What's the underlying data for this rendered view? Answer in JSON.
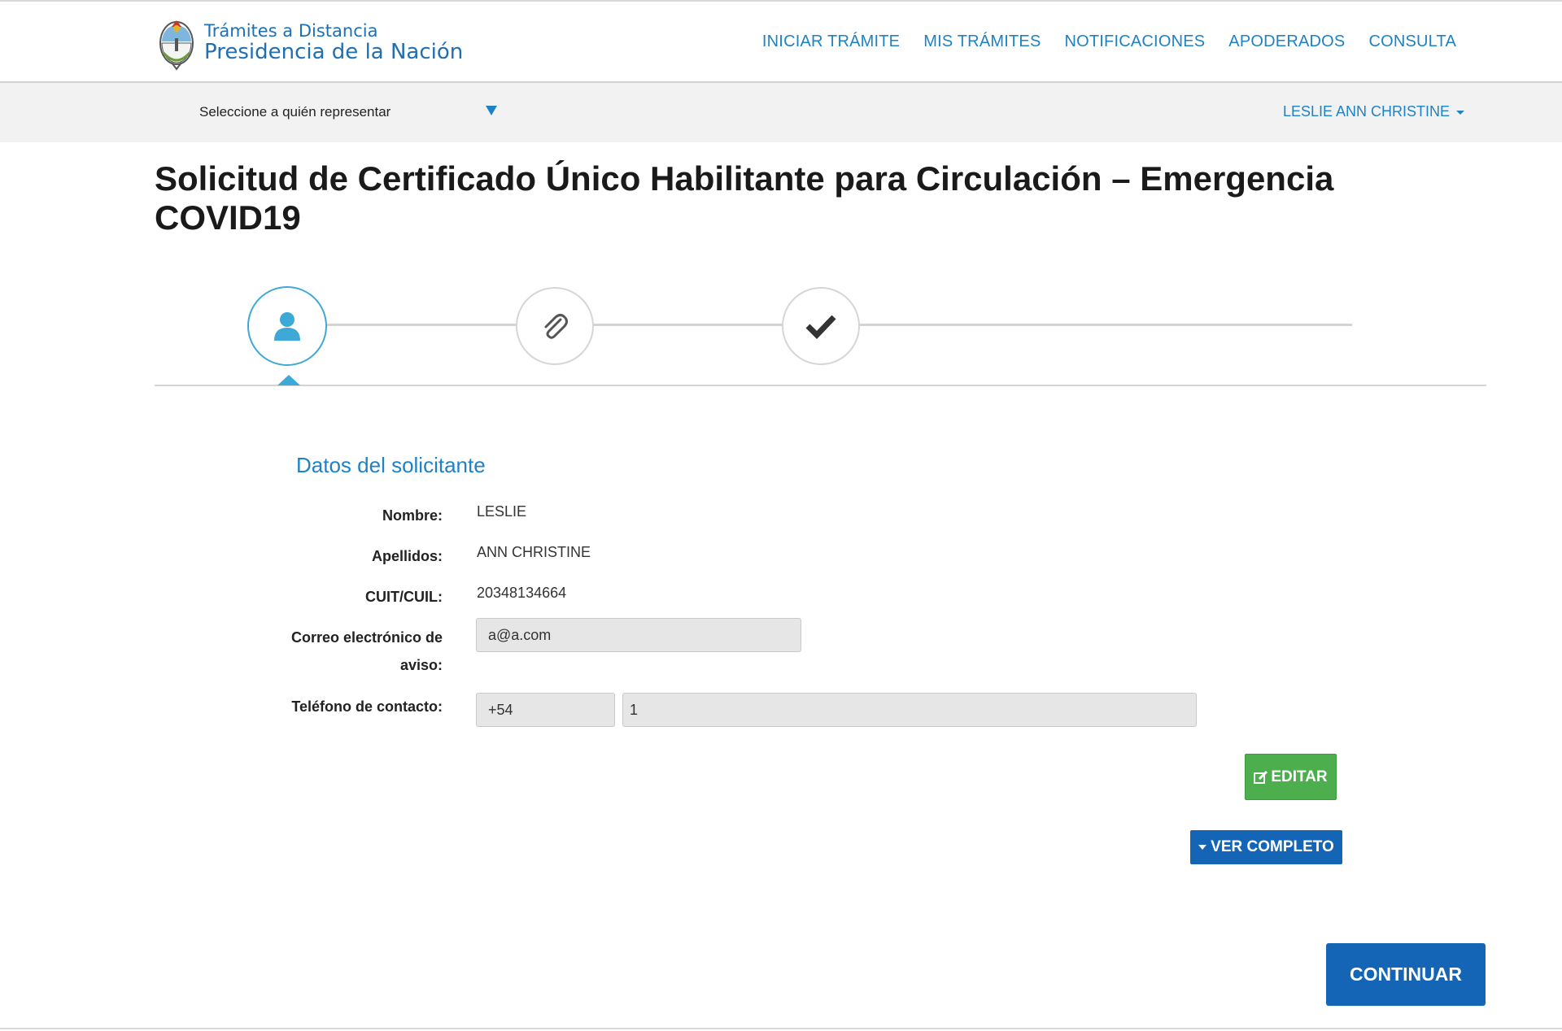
{
  "header": {
    "logo_line1": "Trámites a Distancia",
    "logo_line2": "Presidencia de la Nación",
    "nav": [
      {
        "label": "INICIAR TRÁMITE"
      },
      {
        "label": "MIS TRÁMITES"
      },
      {
        "label": "NOTIFICACIONES"
      },
      {
        "label": "APODERADOS"
      },
      {
        "label": "CONSULTA"
      }
    ]
  },
  "subbar": {
    "represent_placeholder": "Seleccione a quién representar",
    "user_name": "LESLIE ANN CHRISTINE"
  },
  "page_title": "Solicitud de Certificado Único Habilitante para Circulación – Emergencia COVID19",
  "stepper": {
    "steps": [
      {
        "icon": "user-icon",
        "state": "active"
      },
      {
        "icon": "paperclip-icon",
        "state": "pending"
      },
      {
        "icon": "check-icon",
        "state": "pending"
      }
    ]
  },
  "form": {
    "section_title": "Datos del solicitante",
    "nombre_label": "Nombre:",
    "nombre_value": "LESLIE",
    "apellidos_label": "Apellidos:",
    "apellidos_value": "ANN CHRISTINE",
    "cuit_label": "CUIT/CUIL:",
    "cuit_value": "20348134664",
    "email_label_line1": "Correo electrónico de",
    "email_label_line2": "aviso:",
    "email_value": "a@a.com",
    "phone_label": "Teléfono de contacto:",
    "phone_prefix": "+54",
    "phone_number": "1"
  },
  "buttons": {
    "editar": "EDITAR",
    "ver_completo": "VER COMPLETO",
    "continuar": "CONTINUAR"
  },
  "colors": {
    "primary_blue": "#1f82c4",
    "button_blue": "#1565b6",
    "edit_green": "#4cae4c",
    "step_active": "#3ea8d6"
  }
}
